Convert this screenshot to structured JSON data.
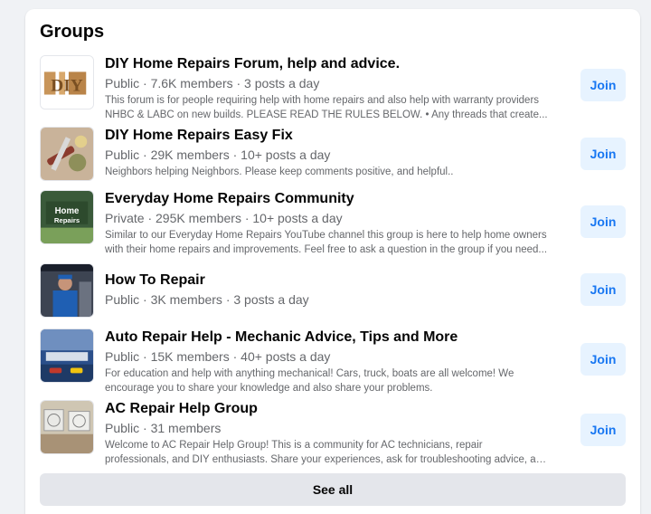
{
  "section": {
    "title": "Groups"
  },
  "join_label": "Join",
  "see_all_label": "See all",
  "groups": [
    {
      "name": "DIY Home Repairs Forum, help and advice.",
      "meta": "Public · 7.6K members · 3 posts a day",
      "description": "This forum is for people requiring help with home repairs and also help with warranty providers NHBC & LABC on new builds. PLEASE READ THE RULES BELOW. • Any threads that create...",
      "thumb_text": "DIY",
      "thumb_icon": "wooden-letters-image"
    },
    {
      "name": "DIY Home Repairs Easy Fix",
      "meta": "Public · 29K members · 10+ posts a day",
      "description": "Neighbors helping Neighbors. Please keep comments positive, and helpful..",
      "thumb_icon": "tools-image"
    },
    {
      "name": "Everyday Home Repairs Community",
      "meta": "Private · 295K members · 10+ posts a day",
      "description": "Similar to our Everyday Home Repairs YouTube channel this group is here to help home owners with their home repairs and improvements. Feel free to ask a question in the group if you need...",
      "thumb_text": "Home Repairs",
      "thumb_icon": "everyday-home-repairs-logo"
    },
    {
      "name": "How To Repair",
      "meta": "Public · 3K members · 3 posts a day",
      "description": "",
      "thumb_icon": "technician-photo"
    },
    {
      "name": "Auto Repair Help - Mechanic Advice, Tips and More",
      "meta": "Public · 15K members · 40+ posts a day",
      "description": "For education and help with anything mechanical! Cars, truck, boats are all welcome! We encourage you to share your knowledge and also share your problems.",
      "thumb_icon": "auto-shop-photo"
    },
    {
      "name": "AC Repair Help Group",
      "meta": "Public · 31 members",
      "description": "Welcome to AC Repair Help Group! This is a community for AC technicians, repair professionals, and DIY enthusiasts. Share your experiences, ask for troubleshooting advice, and discuss the...",
      "thumb_icon": "ac-units-photo"
    }
  ],
  "colors": {
    "accent": "#1877f2",
    "join_bg": "#e7f3ff",
    "see_all_bg": "#e4e6eb",
    "secondary_text": "#65676b"
  }
}
